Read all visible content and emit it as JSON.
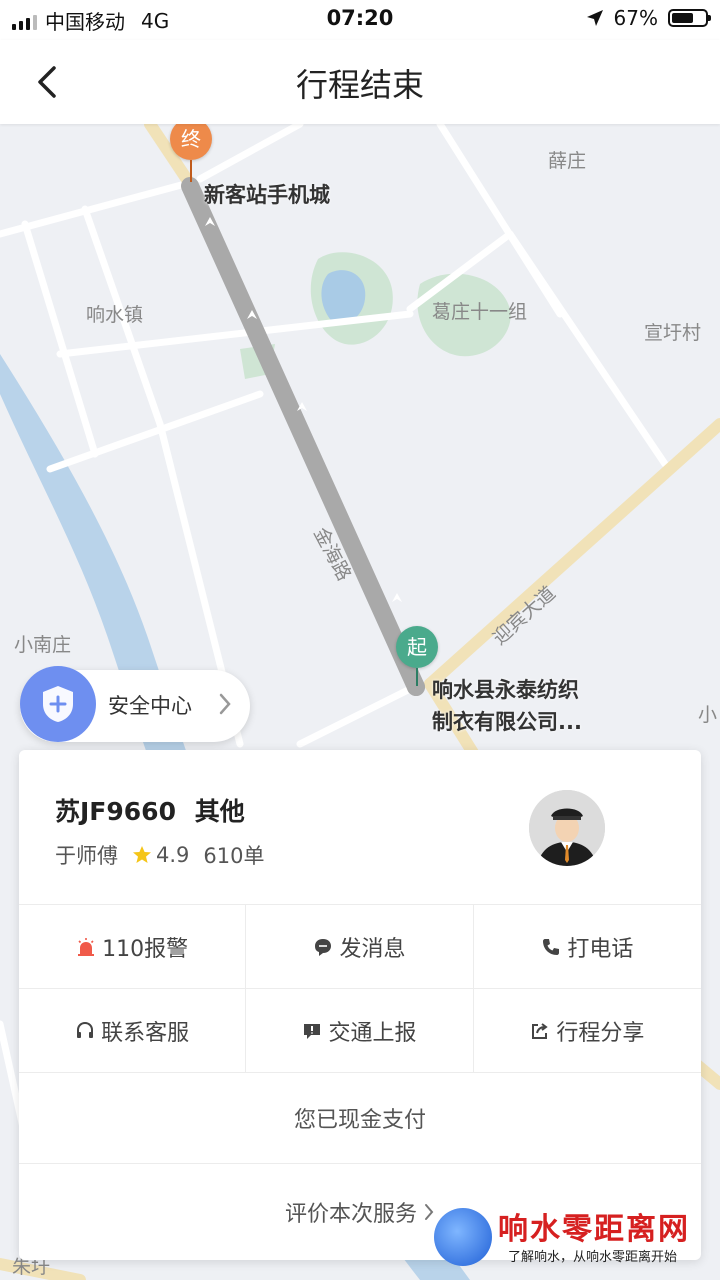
{
  "status_bar": {
    "carrier": "中国移动",
    "network": "4G",
    "time": "07:20",
    "battery_percent": "67%",
    "battery_level": 0.67
  },
  "nav": {
    "title": "行程结束",
    "back_icon": "chevron-left-icon"
  },
  "map": {
    "labels": {
      "xuezhuang": "薛庄",
      "xiangshuizhen": "响水镇",
      "gezhuang": "葛庄十一组",
      "xuanyucun": "宣圩村",
      "jinhailu": "金海路",
      "yingbindadao": "迎宾大道",
      "xiaonanzhuang": "小南庄",
      "zhuyu": "朱圩",
      "edge": "小"
    },
    "end_pin": {
      "text": "终",
      "color": "#ee8a4a"
    },
    "start_pin": {
      "text": "起",
      "color": "#4aaa8c"
    },
    "end_poi": "新客站手机城",
    "start_poi_line1": "响水县永泰纺织",
    "start_poi_line2": "制衣有限公司..."
  },
  "safety_center": {
    "label": "安全中心",
    "icon": "shield-plus-icon",
    "color": "#6e8ff0"
  },
  "driver": {
    "plate": "苏JF9660",
    "car_type": "其他",
    "name": "于师傅",
    "rating": "4.9",
    "orders": "610单"
  },
  "actions": [
    {
      "label": "110报警",
      "icon": "alarm-icon",
      "color": "#f05a4a"
    },
    {
      "label": "发消息",
      "icon": "message-icon",
      "color": "#444"
    },
    {
      "label": "打电话",
      "icon": "phone-icon",
      "color": "#444"
    },
    {
      "label": "联系客服",
      "icon": "headset-icon",
      "color": "#444"
    },
    {
      "label": "交通上报",
      "icon": "report-icon",
      "color": "#444"
    },
    {
      "label": "行程分享",
      "icon": "share-icon",
      "color": "#444"
    }
  ],
  "payment_status": "您已现金支付",
  "rate_service": "评价本次服务",
  "watermark": {
    "title": "响水零距离网",
    "subtitle": "了解响水，从响水零距离开始"
  }
}
